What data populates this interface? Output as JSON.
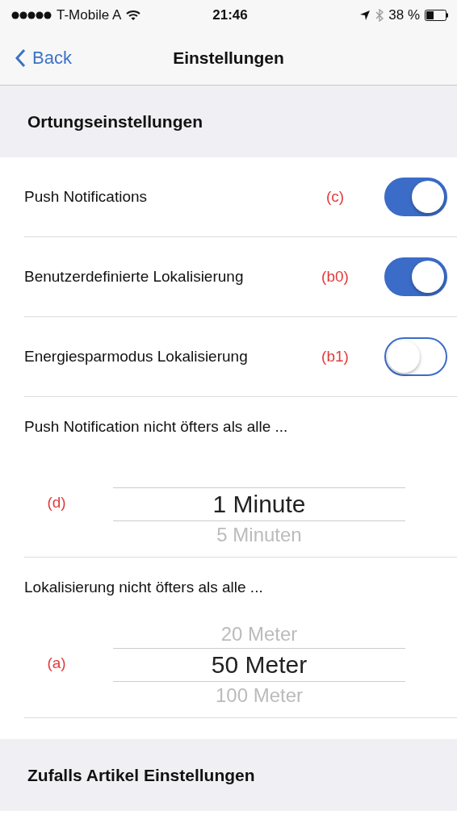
{
  "status_bar": {
    "carrier": "T-Mobile A",
    "time": "21:46",
    "battery": "38 %"
  },
  "nav": {
    "back": "Back",
    "title": "Einstellungen"
  },
  "sections": [
    {
      "title": "Ortungseinstellungen",
      "rows": [
        {
          "kind": "toggle",
          "label": "Push Notifications",
          "tag": "(c)",
          "on": true
        },
        {
          "kind": "toggle",
          "label": "Benutzerdefinierte Lokalisierung",
          "tag": "(b0)",
          "on": true
        },
        {
          "kind": "toggle",
          "label": "Energiesparmodus Lokalisierung",
          "tag": "(b1)",
          "on": false
        },
        {
          "kind": "picker",
          "label": "Push Notification nicht öfters als alle ...",
          "tag": "(d)",
          "items": [
            {
              "text": "1 Minute",
              "selected": true
            },
            {
              "text": "5 Minuten",
              "selected": false
            }
          ]
        },
        {
          "kind": "picker",
          "label": "Lokalisierung nicht öfters als alle ...",
          "tag": "(a)",
          "items": [
            {
              "text": "20 Meter",
              "selected": false
            },
            {
              "text": "50 Meter",
              "selected": true
            },
            {
              "text": "100 Meter",
              "selected": false
            }
          ]
        }
      ]
    },
    {
      "title": "Zufalls Artikel Einstellungen"
    }
  ]
}
